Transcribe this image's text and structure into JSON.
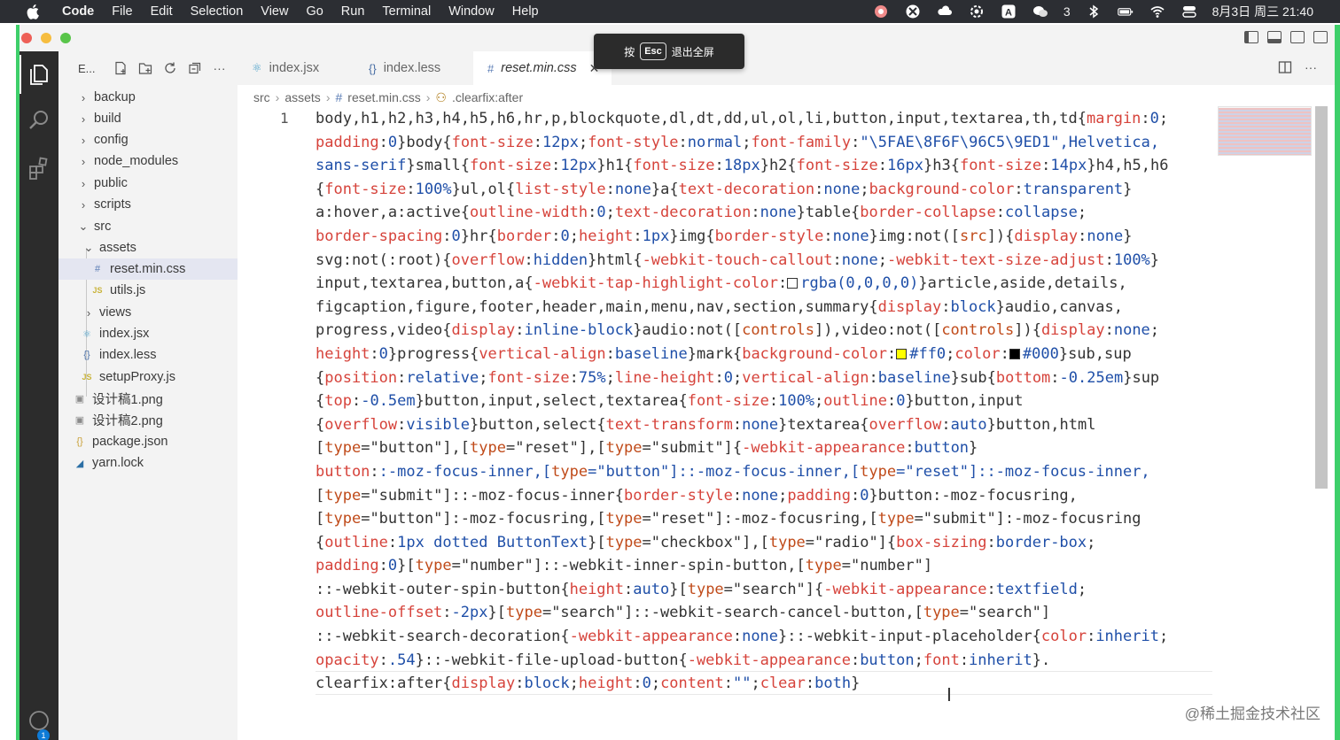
{
  "menubar": {
    "app_name": "Code",
    "items": [
      "File",
      "Edit",
      "Selection",
      "View",
      "Go",
      "Run",
      "Terminal",
      "Window",
      "Help"
    ],
    "wechat_count": "3",
    "datetime": "8月3日 周三 21:40"
  },
  "fullscreen_tip": {
    "before": "按",
    "key": "Esc",
    "after": "退出全屏"
  },
  "sidebar": {
    "title": "E...",
    "tree": [
      {
        "label": "backup",
        "type": "folder",
        "expanded": false
      },
      {
        "label": "build",
        "type": "folder",
        "expanded": false
      },
      {
        "label": "config",
        "type": "folder",
        "expanded": false
      },
      {
        "label": "node_modules",
        "type": "folder",
        "expanded": false
      },
      {
        "label": "public",
        "type": "folder",
        "expanded": false
      },
      {
        "label": "scripts",
        "type": "folder",
        "expanded": false
      },
      {
        "label": "src",
        "type": "folder",
        "expanded": true
      },
      {
        "label": "assets",
        "type": "folder",
        "expanded": true
      },
      {
        "label": "reset.min.css",
        "type": "css",
        "selected": true
      },
      {
        "label": "utils.js",
        "type": "js"
      },
      {
        "label": "views",
        "type": "folder",
        "expanded": false
      },
      {
        "label": "index.jsx",
        "type": "jsx"
      },
      {
        "label": "index.less",
        "type": "less"
      },
      {
        "label": "setupProxy.js",
        "type": "js"
      },
      {
        "label": "设计稿1.png",
        "type": "png"
      },
      {
        "label": "设计稿2.png",
        "type": "png"
      },
      {
        "label": "package.json",
        "type": "json"
      },
      {
        "label": "yarn.lock",
        "type": "lock"
      }
    ]
  },
  "tabs": [
    {
      "label": "index.jsx",
      "icon": "react-icon",
      "active": false
    },
    {
      "label": "index.less",
      "icon": "braces-icon",
      "active": false
    },
    {
      "label": "reset.min.css",
      "icon": "hash-icon",
      "active": true
    }
  ],
  "breadcrumb": [
    "src",
    "assets",
    "reset.min.css",
    ".clearfix:after"
  ],
  "editor": {
    "line_number": "1",
    "code_lines": [
      "body,h1,h2,h3,h4,h5,h6,hr,p,blockquote,dl,dt,dd,ul,ol,li,button,input,textarea,th,td{margin:0;",
      "padding:0}body{font-size:12px;font-style:normal;font-family:\"\\5FAE\\8F6F\\96C5\\9ED1\",Helvetica,",
      "sans-serif}small{font-size:12px}h1{font-size:18px}h2{font-size:16px}h3{font-size:14px}h4,h5,h6",
      "{font-size:100%}ul,ol{list-style:none}a{text-decoration:none;background-color:transparent}",
      "a:hover,a:active{outline-width:0;text-decoration:none}table{border-collapse:collapse;",
      "border-spacing:0}hr{border:0;height:1px}img{border-style:none}img:not([src]){display:none}",
      "svg:not(:root){overflow:hidden}html{-webkit-touch-callout:none;-webkit-text-size-adjust:100%}",
      "input,textarea,button,a{-webkit-tap-highlight-color:☐rgba(0,0,0,0)}article,aside,details,",
      "figcaption,figure,footer,header,main,menu,nav,section,summary{display:block}audio,canvas,",
      "progress,video{display:inline-block}audio:not([controls]),video:not([controls]){display:none;",
      "height:0}progress{vertical-align:baseline}mark{background-color:☐#ff0;color:■#000}sub,sup",
      "{position:relative;font-size:75%;line-height:0;vertical-align:baseline}sub{bottom:-0.25em}sup",
      "{top:-0.5em}button,input,select,textarea{font-size:100%;outline:0}button,input",
      "{overflow:visible}button,select{text-transform:none}textarea{overflow:auto}button,html",
      "[type=\"button\"],[type=\"reset\"],[type=\"submit\"]{-webkit-appearance:button}",
      "button::-moz-focus-inner,[type=\"button\"]::-moz-focus-inner,[type=\"reset\"]::-moz-focus-inner,",
      "[type=\"submit\"]::-moz-focus-inner{border-style:none;padding:0}button:-moz-focusring,",
      "[type=\"button\"]:-moz-focusring,[type=\"reset\"]:-moz-focusring,[type=\"submit\"]:-moz-focusring",
      "{outline:1px dotted ButtonText}[type=\"checkbox\"],[type=\"radio\"]{box-sizing:border-box;",
      "padding:0}[type=\"number\"]::-webkit-inner-spin-button,[type=\"number\"]",
      "::-webkit-outer-spin-button{height:auto}[type=\"search\"]{-webkit-appearance:textfield;",
      "outline-offset:-2px}[type=\"search\"]::-webkit-search-cancel-button,[type=\"search\"]",
      "::-webkit-search-decoration{-webkit-appearance:none}::-webkit-input-placeholder{color:inherit;",
      "opacity:.54}::-webkit-file-upload-button{-webkit-appearance:button;font:inherit}.",
      "clearfix:after{display:block;height:0;content:\"\";clear:both}"
    ]
  },
  "watermark": "@稀土掘金技术社区",
  "activity_badge": "1",
  "colors": {
    "selector": "#333333",
    "property": "#d6433b",
    "value": "#1f4fa8",
    "accent_green": "#3ecf6a"
  }
}
